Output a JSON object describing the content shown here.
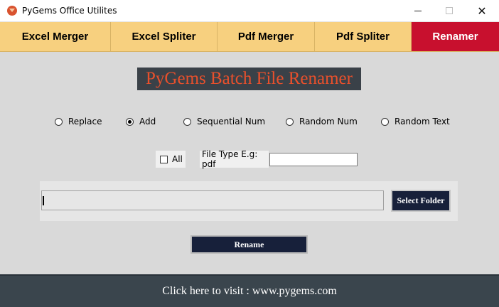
{
  "window": {
    "title": "PyGems Office Utilites",
    "minimize_icon": "minimize-icon",
    "maximize_icon": "maximize-icon",
    "close_glyph": "✕"
  },
  "tabs": [
    {
      "label": "Excel Merger",
      "active": false
    },
    {
      "label": "Excel Spliter",
      "active": false
    },
    {
      "label": "Pdf Merger",
      "active": false
    },
    {
      "label": "Pdf Spliter",
      "active": false
    },
    {
      "label": "Renamer",
      "active": true
    }
  ],
  "main": {
    "heading": "PyGems Batch File Renamer",
    "modes": [
      {
        "label": "Replace",
        "selected": false
      },
      {
        "label": "Add",
        "selected": true
      },
      {
        "label": "Sequential Num",
        "selected": false
      },
      {
        "label": "Random Num",
        "selected": false
      },
      {
        "label": "Random Text",
        "selected": false
      }
    ],
    "all_label": "All",
    "all_checked": false,
    "file_type_label": "File Type E.g: pdf",
    "file_type_value": "",
    "folder_path": "",
    "select_folder_label": "Select Folder",
    "rename_label": "Rename"
  },
  "footer": {
    "link_text": "Click here to visit : www.pygems.com"
  },
  "colors": {
    "tab_bg": "#f7d07f",
    "active_tab_bg": "#c8102e",
    "heading_bg": "#3a4148",
    "heading_text": "#e8502c",
    "button_bg": "#17203a",
    "footer_bg": "#3a454d",
    "main_bg": "#d9d9d9"
  }
}
